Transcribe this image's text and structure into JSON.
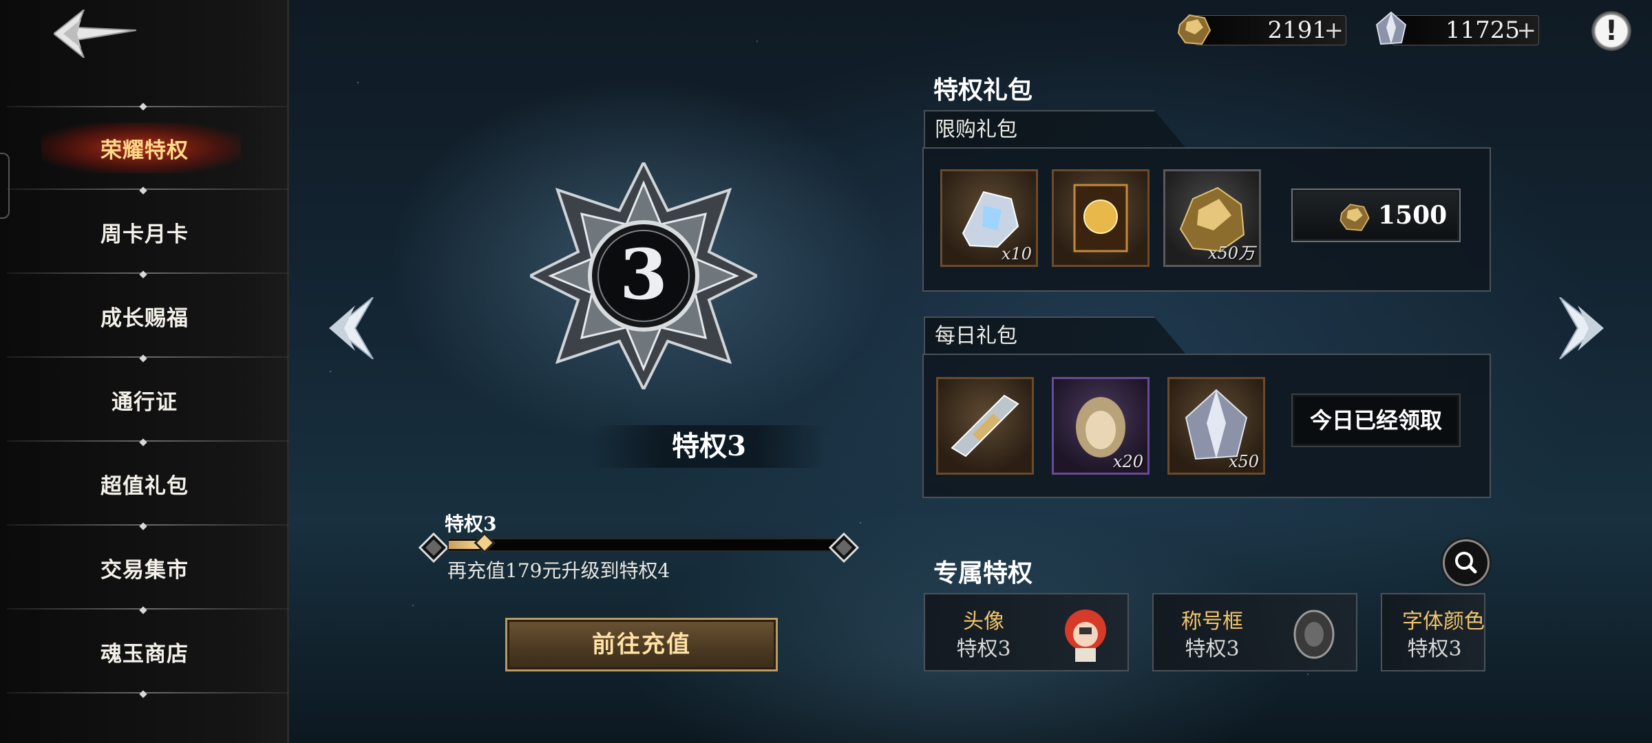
{
  "sidebar": {
    "items": [
      {
        "label": "荣耀特权",
        "active": true
      },
      {
        "label": "周卡月卡"
      },
      {
        "label": "成长赐福"
      },
      {
        "label": "通行证"
      },
      {
        "label": "超值礼包"
      },
      {
        "label": "交易集市"
      },
      {
        "label": "魂玉商店"
      }
    ]
  },
  "currency": {
    "gold": {
      "icon": "gold-ore-icon",
      "amount": "2191",
      "plus": "+"
    },
    "crystal": {
      "icon": "silver-crystal-icon",
      "amount": "11725",
      "plus": "+"
    }
  },
  "info_label": "!",
  "privilege": {
    "badge_number": "3",
    "title": "特权3",
    "progress_label": "特权3",
    "progress_fraction": 0.08,
    "progress_hint": "再充值179元升级到特权4",
    "recharge_button": "前往充值"
  },
  "packs": {
    "section_title": "特权礼包",
    "limited": {
      "tab_label": "限购礼包",
      "items": [
        {
          "icon": "crystal-shard-icon",
          "qty": "x10"
        },
        {
          "icon": "rune-tome-icon",
          "qty": ""
        },
        {
          "icon": "gold-ore-icon",
          "qty": "x50万"
        }
      ],
      "price": "1500"
    },
    "daily": {
      "tab_label": "每日礼包",
      "items": [
        {
          "icon": "blade-shard-icon",
          "qty": ""
        },
        {
          "icon": "portrait-icon",
          "qty": "x20"
        },
        {
          "icon": "silver-crystal-icon",
          "qty": "x50"
        }
      ],
      "claimed_label": "今日已经领取"
    }
  },
  "perks": {
    "section_title": "专属特权",
    "cards": [
      {
        "name": "头像",
        "level": "特权3",
        "icon": "avatar-icon"
      },
      {
        "name": "称号框",
        "level": "特权3",
        "icon": "title-frame-icon"
      },
      {
        "name": "字体颜色",
        "level": "特权3",
        "icon": ""
      }
    ]
  },
  "colors": {
    "accent_gold": "#f2c56a",
    "active_menu": "#ffd98a",
    "button_gold_border": "#b99b62"
  }
}
